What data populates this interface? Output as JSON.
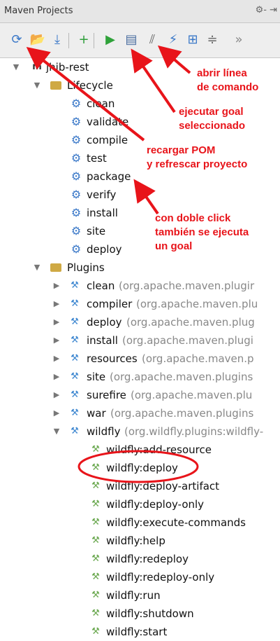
{
  "panel": {
    "title": "Maven Projects",
    "controls": "⚙- ⇥"
  },
  "toolbar": {
    "buttons": [
      {
        "name": "reload-icon",
        "glyph": "⟳",
        "color": "#3a78c8"
      },
      {
        "name": "folder-icon",
        "glyph": "📂",
        "color": "#c49a2c"
      },
      {
        "name": "download-icon",
        "glyph": "⤓",
        "color": "#3a78c8"
      },
      {
        "name": "add-icon",
        "glyph": "+",
        "color": "#2e9e3a"
      },
      {
        "name": "run-icon",
        "glyph": "▶",
        "color": "#2fa23a"
      },
      {
        "name": "terminal-icon",
        "glyph": "▤",
        "color": "#4a6ea0"
      },
      {
        "name": "toggle-offline-icon",
        "glyph": "⫽",
        "color": "#666666"
      },
      {
        "name": "lightning-icon",
        "glyph": "⚡",
        "color": "#3a78c8"
      },
      {
        "name": "diagram-icon",
        "glyph": "⊞",
        "color": "#3a78c8"
      },
      {
        "name": "collapse-icon",
        "glyph": "≑",
        "color": "#666666"
      },
      {
        "name": "more-icon",
        "glyph": "»",
        "color": "#888888"
      }
    ]
  },
  "tree": {
    "project": "jhib-rest",
    "lifecycle_label": "Lifecycle",
    "lifecycle": [
      "clean",
      "validate",
      "compile",
      "test",
      "package",
      "verify",
      "install",
      "site",
      "deploy"
    ],
    "plugins_label": "Plugins",
    "plugins": [
      {
        "name": "clean",
        "detail": "(org.apache.maven.plugir"
      },
      {
        "name": "compiler",
        "detail": "(org.apache.maven.plu"
      },
      {
        "name": "deploy",
        "detail": "(org.apache.maven.plug"
      },
      {
        "name": "install",
        "detail": "(org.apache.maven.plugi"
      },
      {
        "name": "resources",
        "detail": "(org.apache.maven.p"
      },
      {
        "name": "site",
        "detail": "(org.apache.maven.plugins"
      },
      {
        "name": "surefire",
        "detail": "(org.apache.maven.plu"
      },
      {
        "name": "war",
        "detail": "(org.apache.maven.plugins"
      },
      {
        "name": "wildfly",
        "detail": "(org.wildfly.plugins:wildfly-"
      }
    ],
    "wildfly_goals": [
      "wildfly:add-resource",
      "wildfly:deploy",
      "wildfly:deploy-artifact",
      "wildfly:deploy-only",
      "wildfly:execute-commands",
      "wildfly:help",
      "wildfly:redeploy",
      "wildfly:redeploy-only",
      "wildfly:run",
      "wildfly:shutdown",
      "wildfly:start"
    ]
  },
  "annotations": {
    "cmdline": [
      "abrir línea",
      "de comando"
    ],
    "run_goal": [
      "ejecutar goal",
      "seleccionado"
    ],
    "reload": [
      "recargar POM",
      "y refrescar proyecto"
    ],
    "dblclick": [
      "con doble click",
      "también se ejecuta",
      "un goal"
    ]
  },
  "colors": {
    "annotation": "#e8141a",
    "toolbar_bg": "#eeeeee"
  }
}
